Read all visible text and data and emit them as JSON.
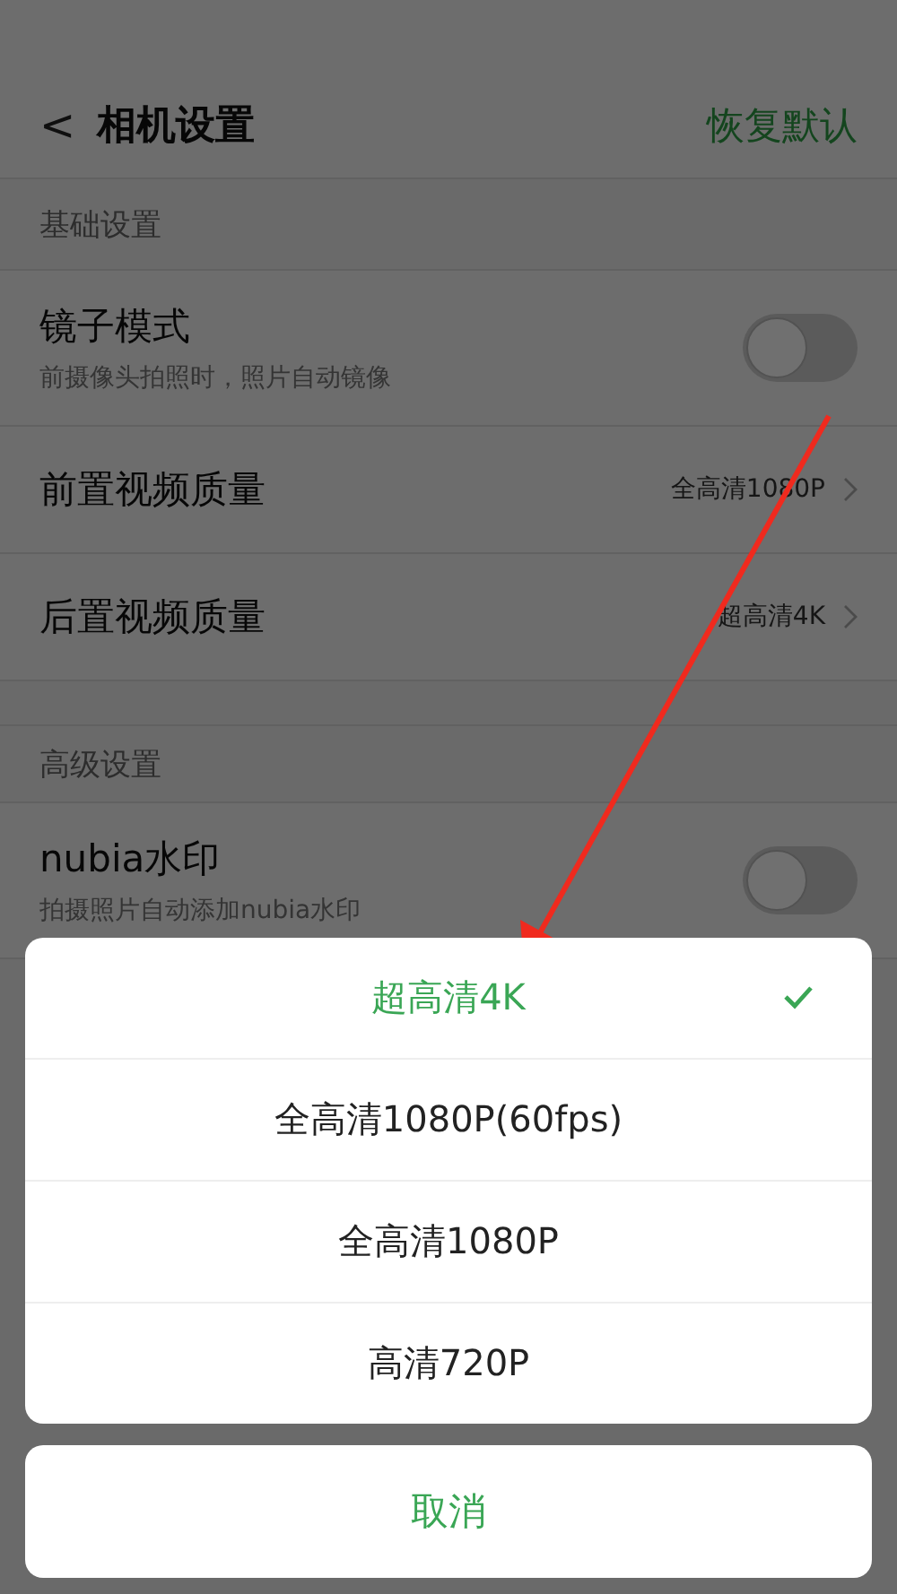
{
  "header": {
    "back": "<",
    "title": "相机设置",
    "action": "恢复默认"
  },
  "sections": [
    {
      "title": "基础设置",
      "rows": [
        {
          "kind": "toggle",
          "label": "镜子模式",
          "subtitle": "前摄像头拍照时，照片自动镜像",
          "on": false
        },
        {
          "kind": "value",
          "label": "前置视频质量",
          "value": "全高清1080P"
        },
        {
          "kind": "value",
          "label": "后置视频质量",
          "value": "超高清4K"
        }
      ]
    },
    {
      "title": "高级设置",
      "rows": [
        {
          "kind": "toggle",
          "label": "nubia水印",
          "subtitle": "拍摄照片自动添加nubia水印",
          "on": false
        }
      ]
    }
  ],
  "sheet": {
    "options": [
      {
        "label": "超高清4K",
        "selected": true
      },
      {
        "label": "全高清1080P(60fps)",
        "selected": false
      },
      {
        "label": "全高清1080P",
        "selected": false
      },
      {
        "label": "高清720P",
        "selected": false
      }
    ],
    "cancel": "取消"
  }
}
